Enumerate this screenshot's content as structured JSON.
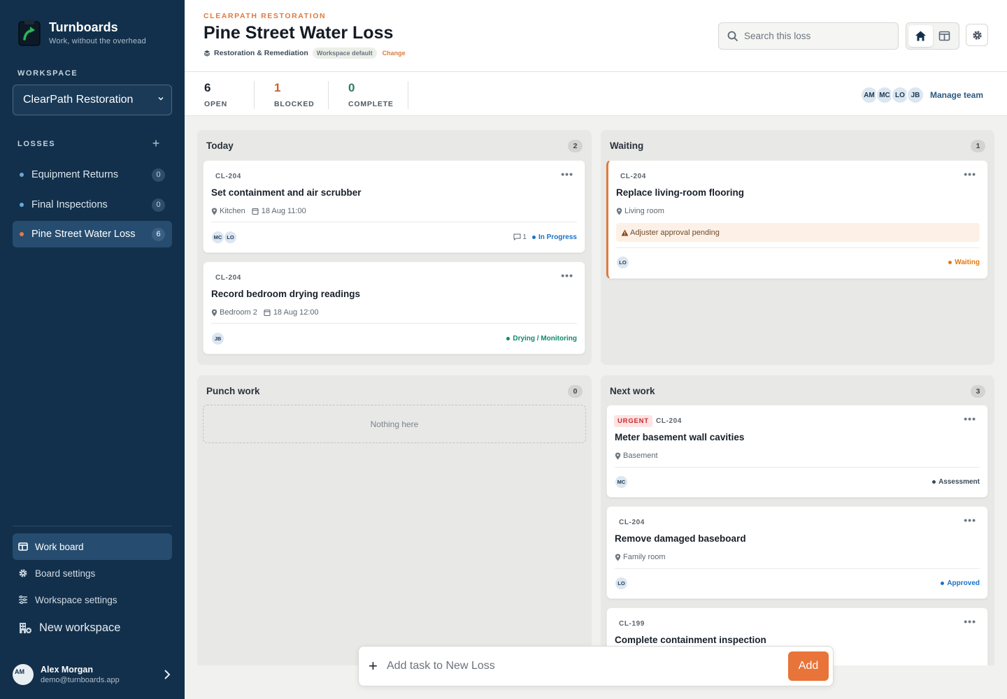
{
  "brand": {
    "name": "Turnboards",
    "tagline": "Work, without the overhead"
  },
  "sidebar": {
    "workspace_label": "WORKSPACE",
    "workspace_value": "ClearPath Restoration",
    "losses_label": "LOSSES",
    "losses": [
      {
        "name": "Equipment Returns",
        "count": "0"
      },
      {
        "name": "Final Inspections",
        "count": "0"
      },
      {
        "name": "Pine Street Water Loss",
        "count": "6"
      }
    ],
    "nav": [
      {
        "label": "Work board",
        "icon": "board-icon"
      },
      {
        "label": "Board settings",
        "icon": "gear-icon"
      },
      {
        "label": "Workspace settings",
        "icon": "sliders-icon"
      },
      {
        "label": "New workspace",
        "icon": "building-add-icon"
      }
    ],
    "user": {
      "initials": "AM",
      "name": "Alex Morgan",
      "email": "demo@turnboards.app"
    }
  },
  "header": {
    "kicker": "CLEARPATH RESTORATION",
    "title": "Pine Street Water Loss",
    "template": "Restoration & Remediation",
    "template_pill": "Workspace default",
    "change": "Change",
    "search_placeholder": "Search this loss"
  },
  "stats": [
    {
      "value": "6",
      "label": "OPEN",
      "color": "#1c2430"
    },
    {
      "value": "1",
      "label": "BLOCKED",
      "color": "#c8622c"
    },
    {
      "value": "0",
      "label": "COMPLETE",
      "color": "#2e7d5b"
    }
  ],
  "team": {
    "members": [
      "AM",
      "MC",
      "LO",
      "JB"
    ],
    "manage": "Manage team"
  },
  "columns": {
    "today": {
      "title": "Today",
      "count": "2",
      "cards": [
        {
          "id": "CL-204",
          "title": "Set containment and air scrubber",
          "location": "Kitchen",
          "date": "18 Aug 11:00",
          "assignees": [
            "MC",
            "LO"
          ],
          "comments": "1",
          "status": "In Progress",
          "status_color": "#1a72c4"
        },
        {
          "id": "CL-204",
          "title": "Record bedroom drying readings",
          "location": "Bedroom 2",
          "date": "18 Aug 12:00",
          "assignees": [
            "JB"
          ],
          "status": "Drying / Monitoring",
          "status_color": "#0f8a6e"
        }
      ]
    },
    "waiting": {
      "title": "Waiting",
      "count": "1",
      "cards": [
        {
          "id": "CL-204",
          "title": "Replace living-room flooring",
          "location": "Living room",
          "alert": "Adjuster approval pending",
          "assignees": [
            "LO"
          ],
          "status": "Waiting",
          "status_color": "#e07a12"
        }
      ]
    },
    "punch": {
      "title": "Punch work",
      "count": "0",
      "empty": "Nothing here"
    },
    "next": {
      "title": "Next work",
      "count": "3",
      "cards": [
        {
          "badge": "URGENT",
          "id": "CL-204",
          "title": "Meter basement wall cavities",
          "location": "Basement",
          "assignees": [
            "MC"
          ],
          "status": "Assessment",
          "status_color": "#3d4a58"
        },
        {
          "id": "CL-204",
          "title": "Remove damaged baseboard",
          "location": "Family room",
          "assignees": [
            "LO"
          ],
          "status": "Approved",
          "status_color": "#1a72c4"
        },
        {
          "id": "CL-199",
          "title": "Complete containment inspection"
        }
      ]
    }
  },
  "addbar": {
    "placeholder": "Add task to New Loss",
    "button": "Add"
  }
}
